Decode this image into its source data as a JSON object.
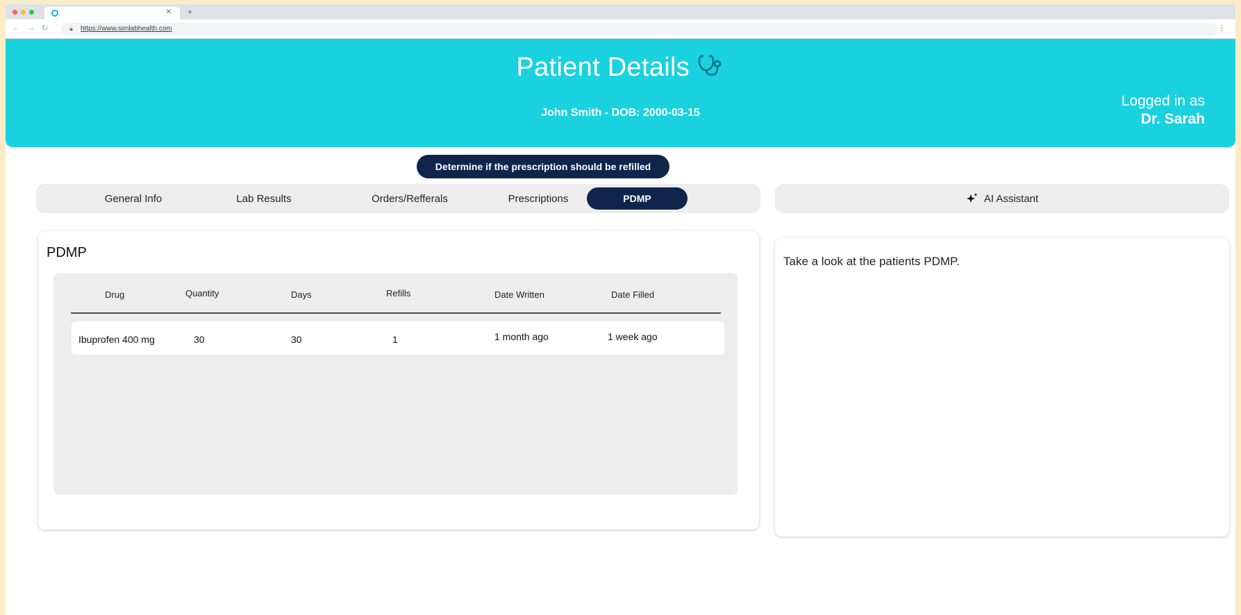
{
  "browser": {
    "url": "https://www.simlabhealth.com",
    "traffic_colors": [
      "#ff5f57",
      "#febc2e",
      "#28c840"
    ]
  },
  "header": {
    "title": "Patient Details",
    "patient_line": "John Smith - DOB: 2000-03-15",
    "login_label": "Logged in as",
    "login_name": "Dr. Sarah",
    "background_color": "#1ad1df"
  },
  "task": {
    "label": "Determine if the prescription should be refilled"
  },
  "tabs": [
    {
      "label": "General Info",
      "active": false
    },
    {
      "label": "Lab Results",
      "active": false
    },
    {
      "label": "Orders/Refferals",
      "active": false
    },
    {
      "label": "Prescriptions",
      "active": false
    },
    {
      "label": "PDMP",
      "active": true
    }
  ],
  "ai_assistant": {
    "label": "AI Assistant",
    "icon": "sparkle-icon",
    "message": "Take a look at the patients PDMP."
  },
  "pdmp": {
    "title": "PDMP",
    "columns": [
      "Drug",
      "Quantity",
      "Days",
      "Refills",
      "Date Written",
      "Date Filled"
    ],
    "rows": [
      [
        "Ibuprofen 400 mg",
        "30",
        "30",
        "1",
        "1 month ago",
        "1 week ago"
      ]
    ]
  },
  "colors": {
    "accent_dark": "#10254b",
    "panel_gray": "#ededed"
  }
}
